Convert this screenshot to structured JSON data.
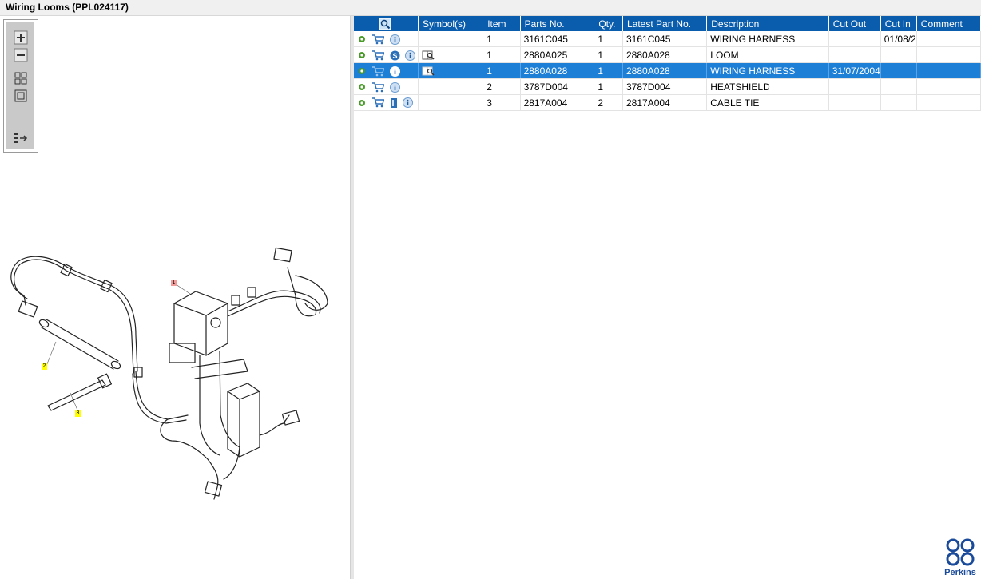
{
  "window": {
    "title": "Wiring Looms (PPL024117)"
  },
  "toolbox": {
    "tools": [
      "zoom-in-icon",
      "zoom-out-icon",
      "fit-all-icon",
      "fit-window-icon",
      "list-toggle-icon"
    ]
  },
  "drawing": {
    "callouts": [
      "1",
      "2",
      "3"
    ]
  },
  "grid": {
    "headers": [
      "",
      "Symbol(s)",
      "Item",
      "Parts No.",
      "Qty.",
      "Latest Part No.",
      "Description",
      "Cut Out",
      "Cut In",
      "Comment"
    ],
    "rows": [
      {
        "item": "1",
        "part_no": "3161C045",
        "qty": "1",
        "latest": "3161C045",
        "desc": "WIRING HARNESS",
        "cut_out": "",
        "cut_in": "01/08/2",
        "comment": ""
      },
      {
        "item": "1",
        "part_no": "2880A025",
        "qty": "1",
        "latest": "2880A028",
        "desc": "LOOM",
        "cut_out": "",
        "cut_in": "",
        "comment": ""
      },
      {
        "item": "1",
        "part_no": "2880A028",
        "qty": "1",
        "latest": "2880A028",
        "desc": "WIRING HARNESS",
        "cut_out": "31/07/2004",
        "cut_in": "",
        "comment": ""
      },
      {
        "item": "2",
        "part_no": "3787D004",
        "qty": "1",
        "latest": "3787D004",
        "desc": "HEATSHIELD",
        "cut_out": "",
        "cut_in": "",
        "comment": ""
      },
      {
        "item": "3",
        "part_no": "2817A004",
        "qty": "2",
        "latest": "2817A004",
        "desc": "CABLE TIE",
        "cut_out": "",
        "cut_in": "",
        "comment": ""
      }
    ]
  },
  "brand": {
    "name": "Perkins"
  },
  "colors": {
    "header": "#0a5cad",
    "selected": "#1e7fd6",
    "callout_yellow": "#ffff00",
    "callout_red": "#f29b9b"
  }
}
